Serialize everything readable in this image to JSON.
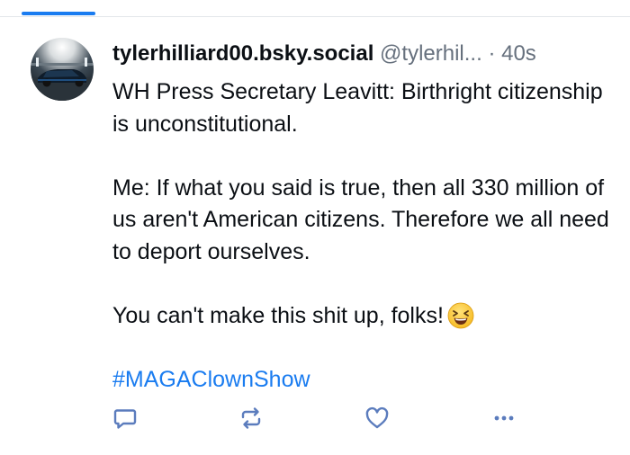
{
  "post": {
    "display_name": "tylerhilliard00.bsky.social",
    "handle": "@tylerhil...",
    "separator": "·",
    "time": "40s",
    "lines": [
      "WH Press Secretary Leavitt: Birthright citizenship is unconstitutional.",
      "Me: If what you said is true, then all 330 million of us aren't American citizens. Therefore we all need to deport ourselves.",
      "You can't make this shit up, folks!"
    ],
    "hashtag": "#MAGAClownShow"
  },
  "icons": {
    "reply": "reply-icon",
    "repost": "repost-icon",
    "like": "heart-icon",
    "more": "more-icon",
    "emoji": "laughing-face-emoji"
  },
  "colors": {
    "accent": "#1a7cf0",
    "text": "#0b0f14",
    "muted": "#66707d",
    "action_icon": "#5b7cbd"
  }
}
